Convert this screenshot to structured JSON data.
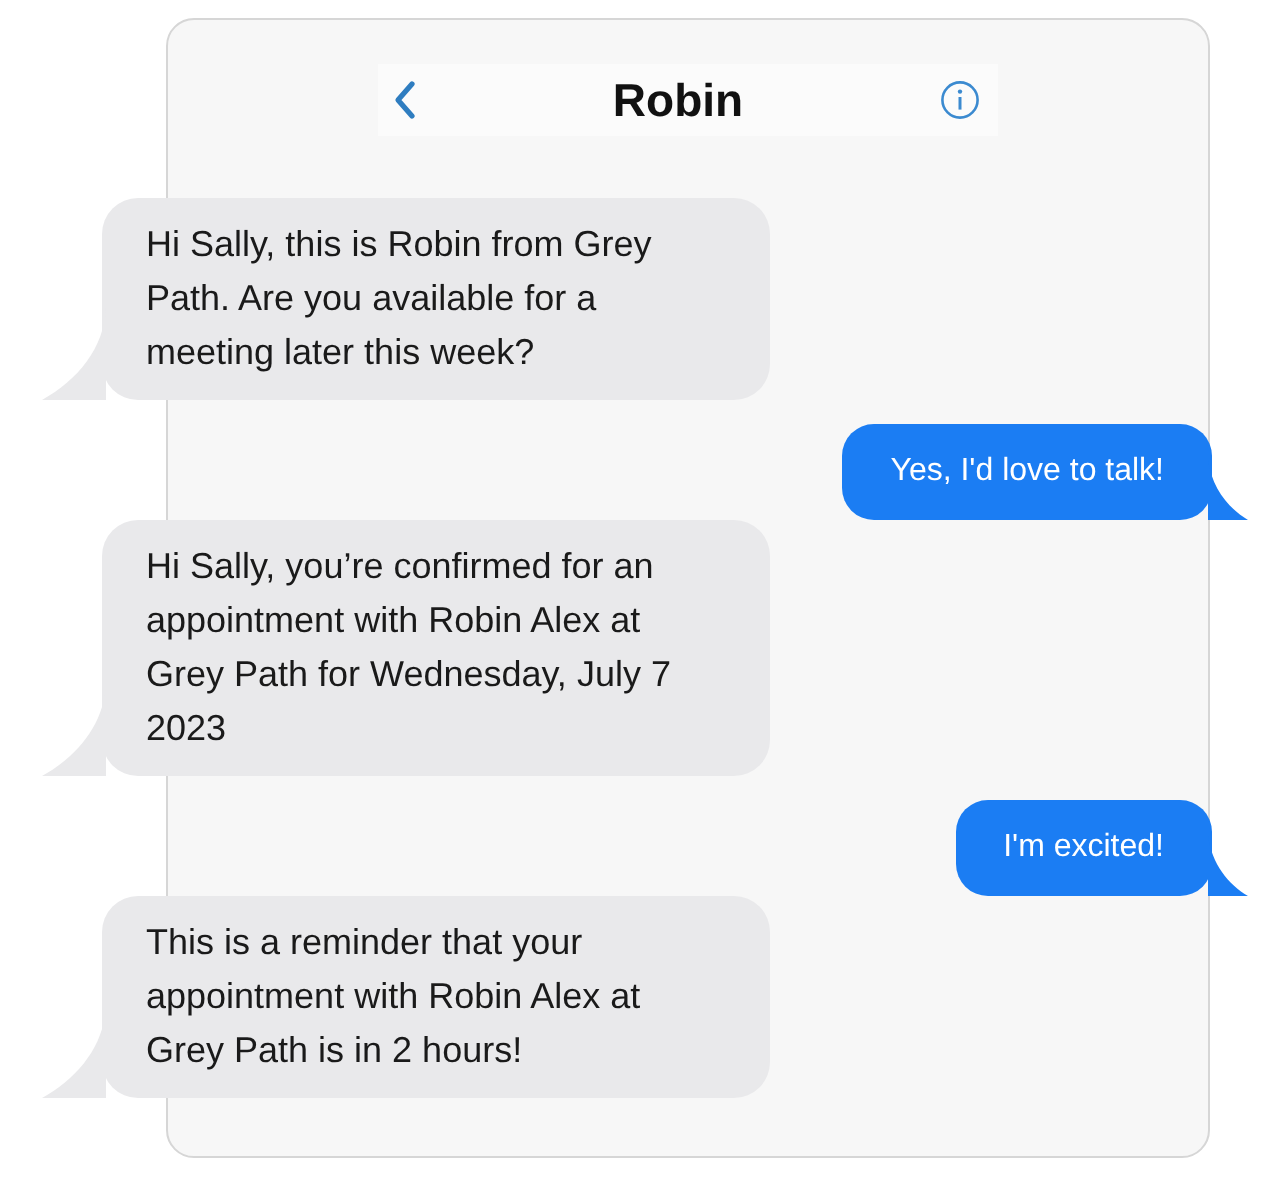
{
  "header": {
    "title": "Robin"
  },
  "messages": [
    {
      "kind": "incoming",
      "text": "Hi Sally, this is Robin from Grey Path. Are you available for a meeting later this week?"
    },
    {
      "kind": "outgoing",
      "text": "Yes, I'd love to talk!"
    },
    {
      "kind": "incoming",
      "text": "Hi Sally, you’re confirmed for an appointment with Robin Alex at Grey Path for Wednesday, July 7 2023"
    },
    {
      "kind": "outgoing",
      "text": "I'm excited!"
    },
    {
      "kind": "incoming",
      "text": "This is a reminder that your appointment with Robin Alex at Grey Path is in 2 hours!"
    }
  ]
}
